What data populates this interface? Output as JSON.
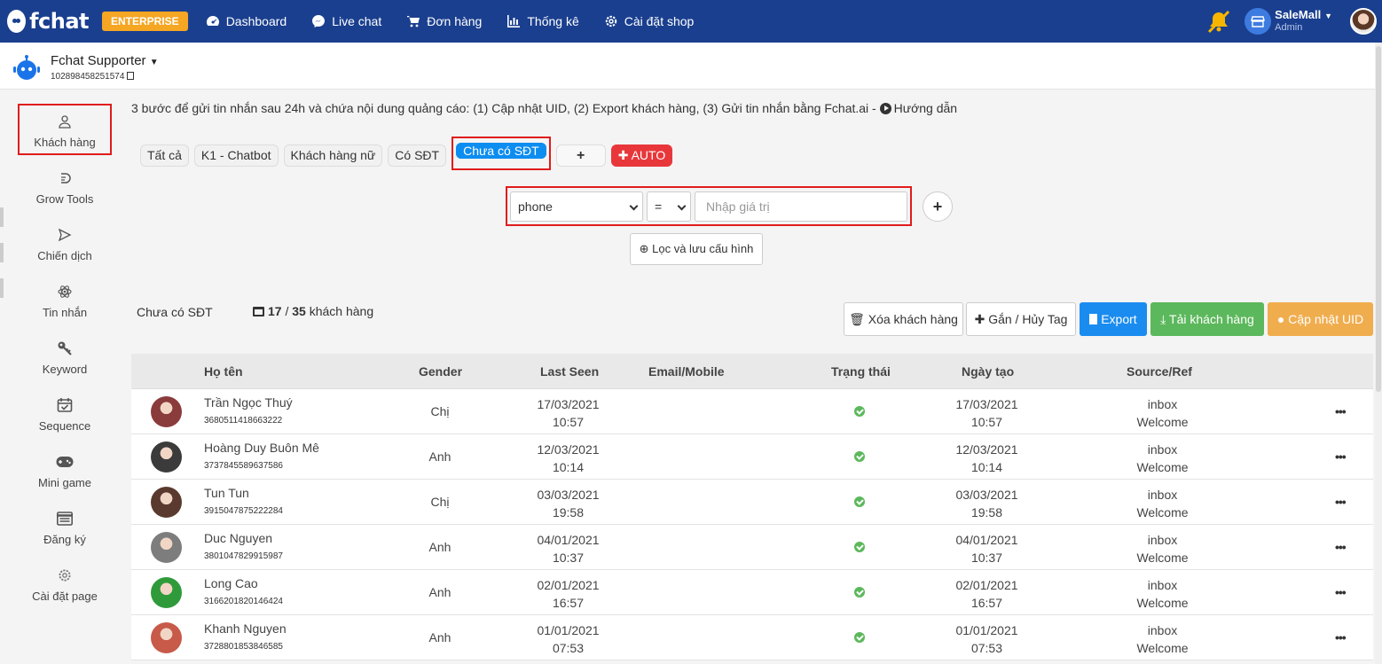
{
  "topbar": {
    "logo": "fchat",
    "badge": "ENTERPRISE",
    "nav": [
      {
        "label": "Dashboard",
        "icon": "dashboard-icon"
      },
      {
        "label": "Live chat",
        "icon": "messenger-icon"
      },
      {
        "label": "Đơn hàng",
        "icon": "cart-icon"
      },
      {
        "label": "Thống kê",
        "icon": "bar-chart-icon"
      },
      {
        "label": "Cài đặt shop",
        "icon": "gear-icon"
      }
    ],
    "user_name": "SaleMall",
    "user_role": "Admin"
  },
  "page": {
    "name": "Fchat Supporter",
    "id": "102898458251574"
  },
  "sidebar": {
    "items": [
      {
        "label": "Khách hàng",
        "icon": "user-icon"
      },
      {
        "label": "Grow Tools",
        "icon": "grow-tools-icon"
      },
      {
        "label": "Chiến dịch",
        "icon": "send-icon"
      },
      {
        "label": "Tin nhắn",
        "icon": "atom-icon"
      },
      {
        "label": "Keyword",
        "icon": "key-icon"
      },
      {
        "label": "Sequence",
        "icon": "calendar-check-icon"
      },
      {
        "label": "Mini game",
        "icon": "gamepad-icon"
      },
      {
        "label": "Đăng ký",
        "icon": "form-icon"
      },
      {
        "label": "Cài đặt page",
        "icon": "settings-icon"
      }
    ]
  },
  "hint": {
    "text": "3 bước để gửi tin nhắn sau 24h và chứa nội dung quảng cáo: (1) Cập nhật UID, (2) Export khách hàng, (3) Gửi tin nhắn bằng Fchat.ai - ",
    "link": "Hướng dẫn"
  },
  "segments": {
    "tabs": [
      "Tất cả",
      "K1 - Chatbot",
      "Khách hàng nữ",
      "Có SĐT"
    ],
    "active": "Chưa có SĐT",
    "add": "+",
    "auto": "AUTO"
  },
  "filter": {
    "field": "phone",
    "operator": "=",
    "value_placeholder": "Nhập giá trị",
    "save_label": "Lọc và lưu cấu hình"
  },
  "summary": {
    "segment_name": "Chưa có SĐT",
    "shown": "17",
    "separator": "/",
    "total": "35",
    "unit": "khách hàng"
  },
  "actions": {
    "delete": "Xóa khách hàng",
    "tag": "Gắn / Hủy Tag",
    "export": "Export",
    "download": "Tải khách hàng",
    "update_uid": "Cập nhật UID"
  },
  "table": {
    "headers": {
      "name": "Họ tên",
      "gender": "Gender",
      "last_seen": "Last Seen",
      "email": "Email/Mobile",
      "status": "Trạng thái",
      "created": "Ngày tạo",
      "source": "Source/Ref"
    },
    "rows": [
      {
        "name": "Trần Ngọc Thuý",
        "uid": "3680511418663222",
        "gender": "Chị",
        "ls_date": "17/03/2021",
        "ls_time": "10:57",
        "cd_date": "17/03/2021",
        "cd_time": "10:57",
        "src": "inbox",
        "ref": "Welcome",
        "av": "#8a3b3b"
      },
      {
        "name": "Hoàng Duy Buôn Mê",
        "uid": "3737845589637586",
        "gender": "Anh",
        "ls_date": "12/03/2021",
        "ls_time": "10:14",
        "cd_date": "12/03/2021",
        "cd_time": "10:14",
        "src": "inbox",
        "ref": "Welcome",
        "av": "#3b3b3b"
      },
      {
        "name": "Tun Tun",
        "uid": "3915047875222284",
        "gender": "Chị",
        "ls_date": "03/03/2021",
        "ls_time": "19:58",
        "cd_date": "03/03/2021",
        "cd_time": "19:58",
        "src": "inbox",
        "ref": "Welcome",
        "av": "#5a3a2e"
      },
      {
        "name": "Duc Nguyen",
        "uid": "3801047829915987",
        "gender": "Anh",
        "ls_date": "04/01/2021",
        "ls_time": "10:37",
        "cd_date": "04/01/2021",
        "cd_time": "10:37",
        "src": "inbox",
        "ref": "Welcome",
        "av": "#7d7d7d"
      },
      {
        "name": "Long Cao",
        "uid": "3166201820146424",
        "gender": "Anh",
        "ls_date": "02/01/2021",
        "ls_time": "16:57",
        "cd_date": "02/01/2021",
        "cd_time": "16:57",
        "src": "inbox",
        "ref": "Welcome",
        "av": "#2f9a3a"
      },
      {
        "name": "Khanh Nguyen",
        "uid": "3728801853846585",
        "gender": "Anh",
        "ls_date": "01/01/2021",
        "ls_time": "07:53",
        "cd_date": "01/01/2021",
        "cd_time": "07:53",
        "src": "inbox",
        "ref": "Welcome",
        "av": "#c85a4a"
      }
    ]
  }
}
